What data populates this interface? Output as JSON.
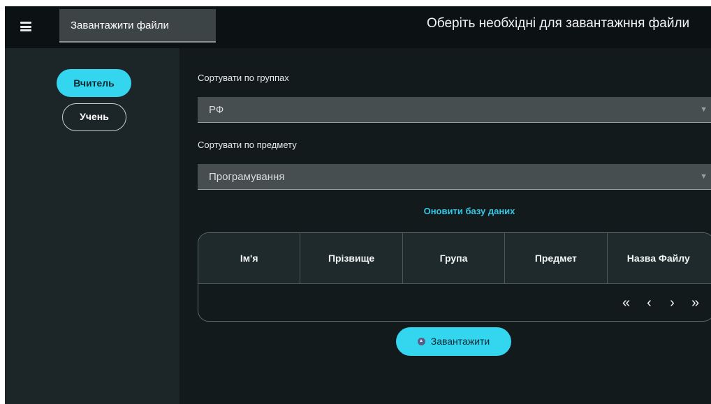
{
  "topbar": {
    "tab_label": "Завантажити файли",
    "title": "Оберіть необхідні для завантажння файли"
  },
  "sidebar": {
    "teacher_label": "Вчитель",
    "student_label": "Учень"
  },
  "filters": {
    "group_label": "Сортувати по группах",
    "group_value": "РФ",
    "subject_label": "Сортувати по предмету",
    "subject_value": "Програмування"
  },
  "refresh_label": "Оновити базу даних",
  "table": {
    "columns": [
      "Ім'я",
      "Прізвище",
      "Група",
      "Предмет",
      "Назва Файлу"
    ]
  },
  "pager": {
    "first": "«",
    "prev": "‹",
    "next": "›",
    "last": "»"
  },
  "upload_label": "Завантажити",
  "colors": {
    "accent": "#34d5ee",
    "background": "#131a1c",
    "sidebar": "#1c2528"
  }
}
